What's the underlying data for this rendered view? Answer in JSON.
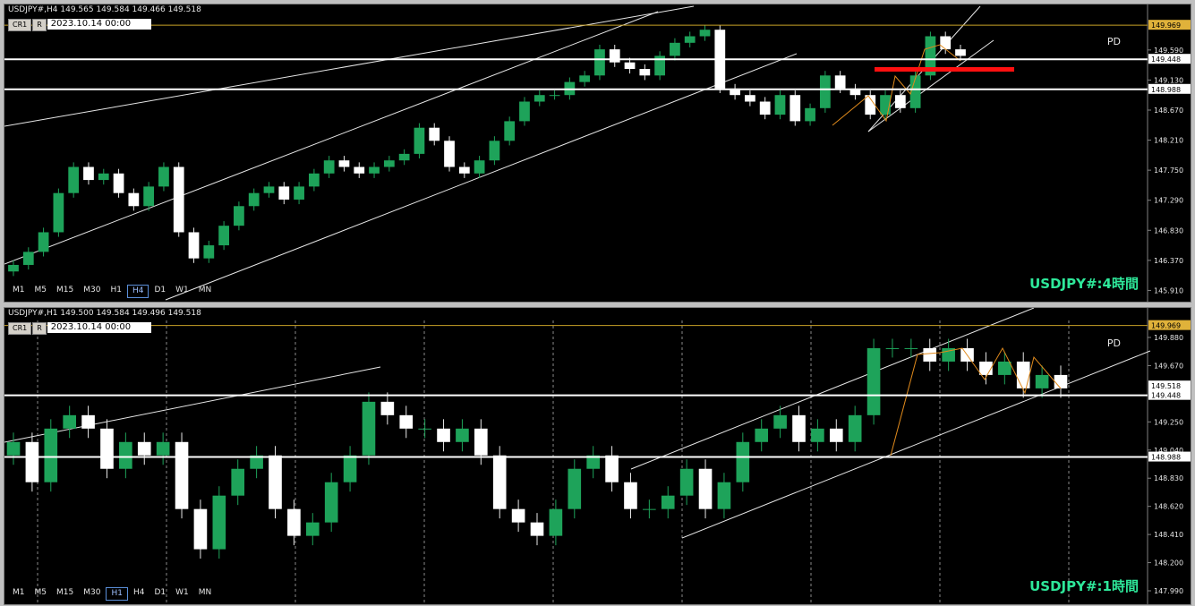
{
  "top": {
    "header": "USDJPY#,H4  149.565 149.584 149.466 149.518",
    "buttons": [
      "CR1",
      "R"
    ],
    "datetime": "2023.10.14 00:00",
    "timeframes": [
      "M1",
      "M5",
      "M15",
      "M30",
      "H1",
      "H4",
      "D1",
      "W1",
      "MN"
    ],
    "selected_tf": "H4",
    "label": "USDJPY#:4時間",
    "pd": "PD",
    "price_labels": [
      "149.969",
      "149.448",
      "148.988"
    ],
    "ticks": [
      "149.590",
      "149.130",
      "148.670",
      "148.210",
      "147.750",
      "147.290",
      "146.830",
      "146.370",
      "145.910"
    ]
  },
  "bottom": {
    "header": "USDJPY#,H1  149.500 149.584 149.496 149.518",
    "buttons": [
      "CR1",
      "R"
    ],
    "datetime": "2023.10.14 00:00",
    "timeframes": [
      "M1",
      "M5",
      "M15",
      "M30",
      "H1",
      "H4",
      "D1",
      "W1",
      "MN"
    ],
    "selected_tf": "H1",
    "label": "USDJPY#:1時間",
    "pd": "PD",
    "price_labels": [
      "149.969",
      "149.518",
      "149.448",
      "148.988"
    ],
    "ticks": [
      "149.880",
      "149.670",
      "149.250",
      "149.040",
      "148.830",
      "148.620",
      "148.410",
      "148.200",
      "147.990"
    ]
  },
  "chart_data": [
    {
      "type": "candlestick",
      "title": "USDJPY#,H4",
      "ylim": [
        145.82,
        150.04
      ],
      "horizontal_lines": [
        149.969,
        149.448,
        148.988
      ],
      "series": [
        {
          "name": "USDJPY#",
          "close": [
            146.3,
            146.5,
            146.8,
            147.4,
            147.8,
            147.6,
            147.7,
            147.4,
            147.2,
            147.5,
            147.8,
            146.8,
            146.4,
            146.6,
            146.9,
            147.2,
            147.4,
            147.5,
            147.3,
            147.5,
            147.7,
            147.9,
            147.8,
            147.7,
            147.8,
            147.9,
            148.0,
            148.4,
            148.2,
            147.8,
            147.7,
            147.9,
            148.2,
            148.5,
            148.8,
            148.9,
            148.9,
            149.1,
            149.2,
            149.6,
            149.4,
            149.3,
            149.2,
            149.5,
            149.7,
            149.8,
            149.9,
            149.0,
            148.9,
            148.8,
            148.6,
            148.9,
            148.5,
            148.7,
            149.2,
            149.0,
            148.9,
            148.6,
            148.9,
            148.7,
            149.2,
            149.8,
            149.6,
            149.5
          ]
        }
      ]
    },
    {
      "type": "candlestick",
      "title": "USDJPY#,H1",
      "ylim": [
        147.93,
        149.98
      ],
      "horizontal_lines": [
        149.969,
        149.518,
        149.448,
        148.988
      ],
      "series": [
        {
          "name": "USDJPY#",
          "close": [
            149.1,
            148.8,
            149.2,
            149.3,
            149.2,
            148.9,
            149.1,
            149.0,
            149.1,
            148.6,
            148.3,
            148.7,
            148.9,
            149.0,
            148.6,
            148.4,
            148.5,
            148.8,
            149.0,
            149.4,
            149.3,
            149.2,
            149.2,
            149.1,
            149.2,
            149.0,
            148.6,
            148.5,
            148.4,
            148.6,
            148.9,
            149.0,
            148.8,
            148.6,
            148.6,
            148.7,
            148.9,
            148.6,
            148.8,
            149.1,
            149.2,
            149.3,
            149.1,
            149.2,
            149.1,
            149.3,
            149.8,
            149.8,
            149.8,
            149.7,
            149.8,
            149.7,
            149.6,
            149.7,
            149.5,
            149.6,
            149.5
          ]
        }
      ]
    }
  ]
}
